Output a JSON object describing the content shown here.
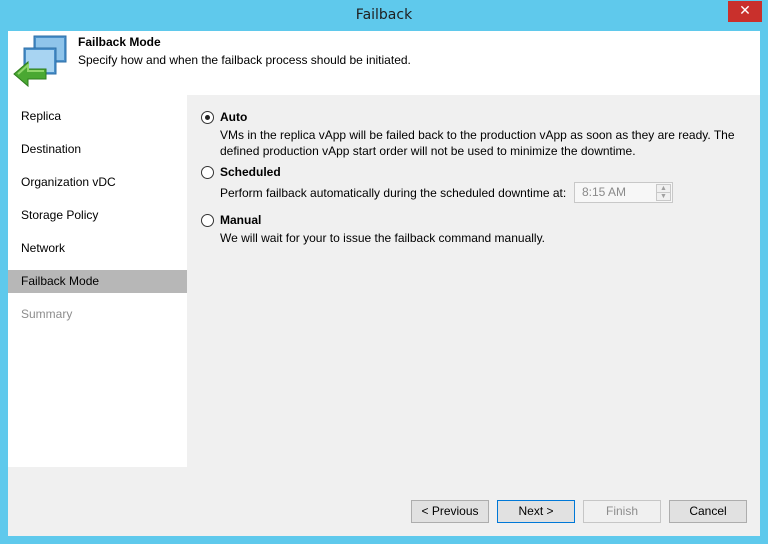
{
  "window": {
    "title": "Failback",
    "close_glyph": "✕",
    "close_icon": "close-icon"
  },
  "header": {
    "title": "Failback Mode",
    "subtitle": "Specify how and when the failback process should be initiated.",
    "icon": "failback-arrow-icon"
  },
  "sidebar": {
    "items": [
      {
        "label": "Replica",
        "state": "normal"
      },
      {
        "label": "Destination",
        "state": "normal"
      },
      {
        "label": "Organization vDC",
        "state": "normal"
      },
      {
        "label": "Storage Policy",
        "state": "normal"
      },
      {
        "label": "Network",
        "state": "normal"
      },
      {
        "label": "Failback Mode",
        "state": "active"
      },
      {
        "label": "Summary",
        "state": "disabled"
      }
    ]
  },
  "options": {
    "auto": {
      "label": "Auto",
      "checked": true,
      "desc_line1": "VMs in the replica vApp will be failed back to the production vApp as soon as they are ready. The",
      "desc_line2": "defined production vApp start order will not be used to minimize the downtime."
    },
    "scheduled": {
      "label": "Scheduled",
      "checked": false,
      "desc": "Perform failback automatically during the scheduled downtime at:",
      "time_value": "8:15 AM",
      "spin_up": "▲",
      "spin_down": "▼"
    },
    "manual": {
      "label": "Manual",
      "checked": false,
      "desc": "We will wait for your to issue the failback command manually."
    }
  },
  "footer": {
    "previous_label": "< Previous",
    "next_label": "Next >",
    "finish_label": "Finish",
    "cancel_label": "Cancel"
  },
  "colors": {
    "titlebar": "#5fc9ec",
    "close": "#c9302c",
    "active_nav": "#b7b7b7",
    "default_button_border": "#0078d7"
  }
}
